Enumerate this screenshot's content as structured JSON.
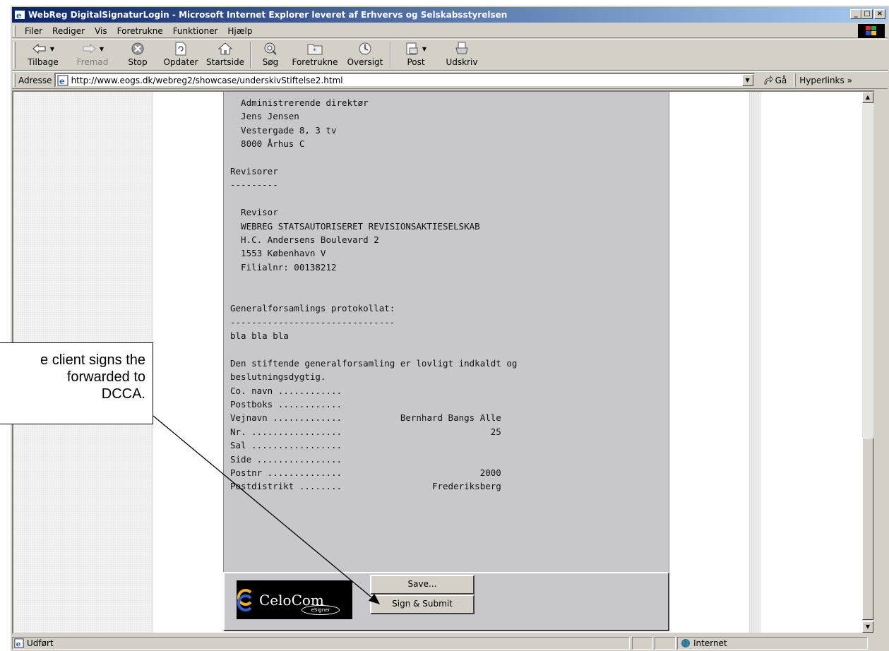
{
  "window": {
    "title": "WebReg DigitalSignaturLogin - Microsoft Internet Explorer leveret af Erhvervs og Selskabsstyrelsen",
    "controls": [
      "minimize-icon",
      "maximize-icon",
      "close-icon"
    ]
  },
  "menu": {
    "items": [
      "Filer",
      "Rediger",
      "Vis",
      "Foretrukne",
      "Funktioner",
      "Hjælp"
    ]
  },
  "toolbar": {
    "back": "Tilbage",
    "forward": "Fremad",
    "stop": "Stop",
    "refresh": "Opdater",
    "home": "Startside",
    "search": "Søg",
    "favorites": "Foretrukne",
    "history": "Oversigt",
    "mail": "Post",
    "print": "Udskriv"
  },
  "address": {
    "label": "Adresse",
    "url": "http://www.eogs.dk/webreg2/showcase/underskivStiftelse2.html",
    "go": "Gå",
    "links": "Hyperlinks"
  },
  "document": {
    "lines": [
      "  Administrerende direktør",
      "  Jens Jensen",
      "  Vestergade 8, 3 tv",
      "  8000 Århus C",
      "",
      "Revisorer",
      "---------",
      "",
      "  Revisor",
      "  WEBREG STATSAUTORISERET REVISIONSAKTIESELSKAB",
      "  H.C. Andersens Boulevard 2",
      "  1553 København V",
      "  Filialnr: 00138212",
      "",
      "",
      "Generalforsamlings protokollat:",
      "-------------------------------",
      "bla bla bla",
      "",
      "Den stiftende generalforsamling er lovligt indkaldt og",
      "beslutningsdygtig.",
      "Co. navn ............",
      "Postboks ............",
      "Vejnavn .............           Bernhard Bangs Alle",
      "Nr. .................                            25",
      "Sal .................",
      "Side ................",
      "Postnr ..............                          2000",
      "Postdistrikt ........                 Frederiksberg"
    ]
  },
  "signer": {
    "brand": "CeloCom",
    "sub": "eSigner",
    "save_label": "Save...",
    "submit_label": "Sign & Submit"
  },
  "status": {
    "text": "Udført",
    "zone": "Internet"
  },
  "callout": {
    "text": "e client signs the\n forwarded to\nDCCA."
  }
}
